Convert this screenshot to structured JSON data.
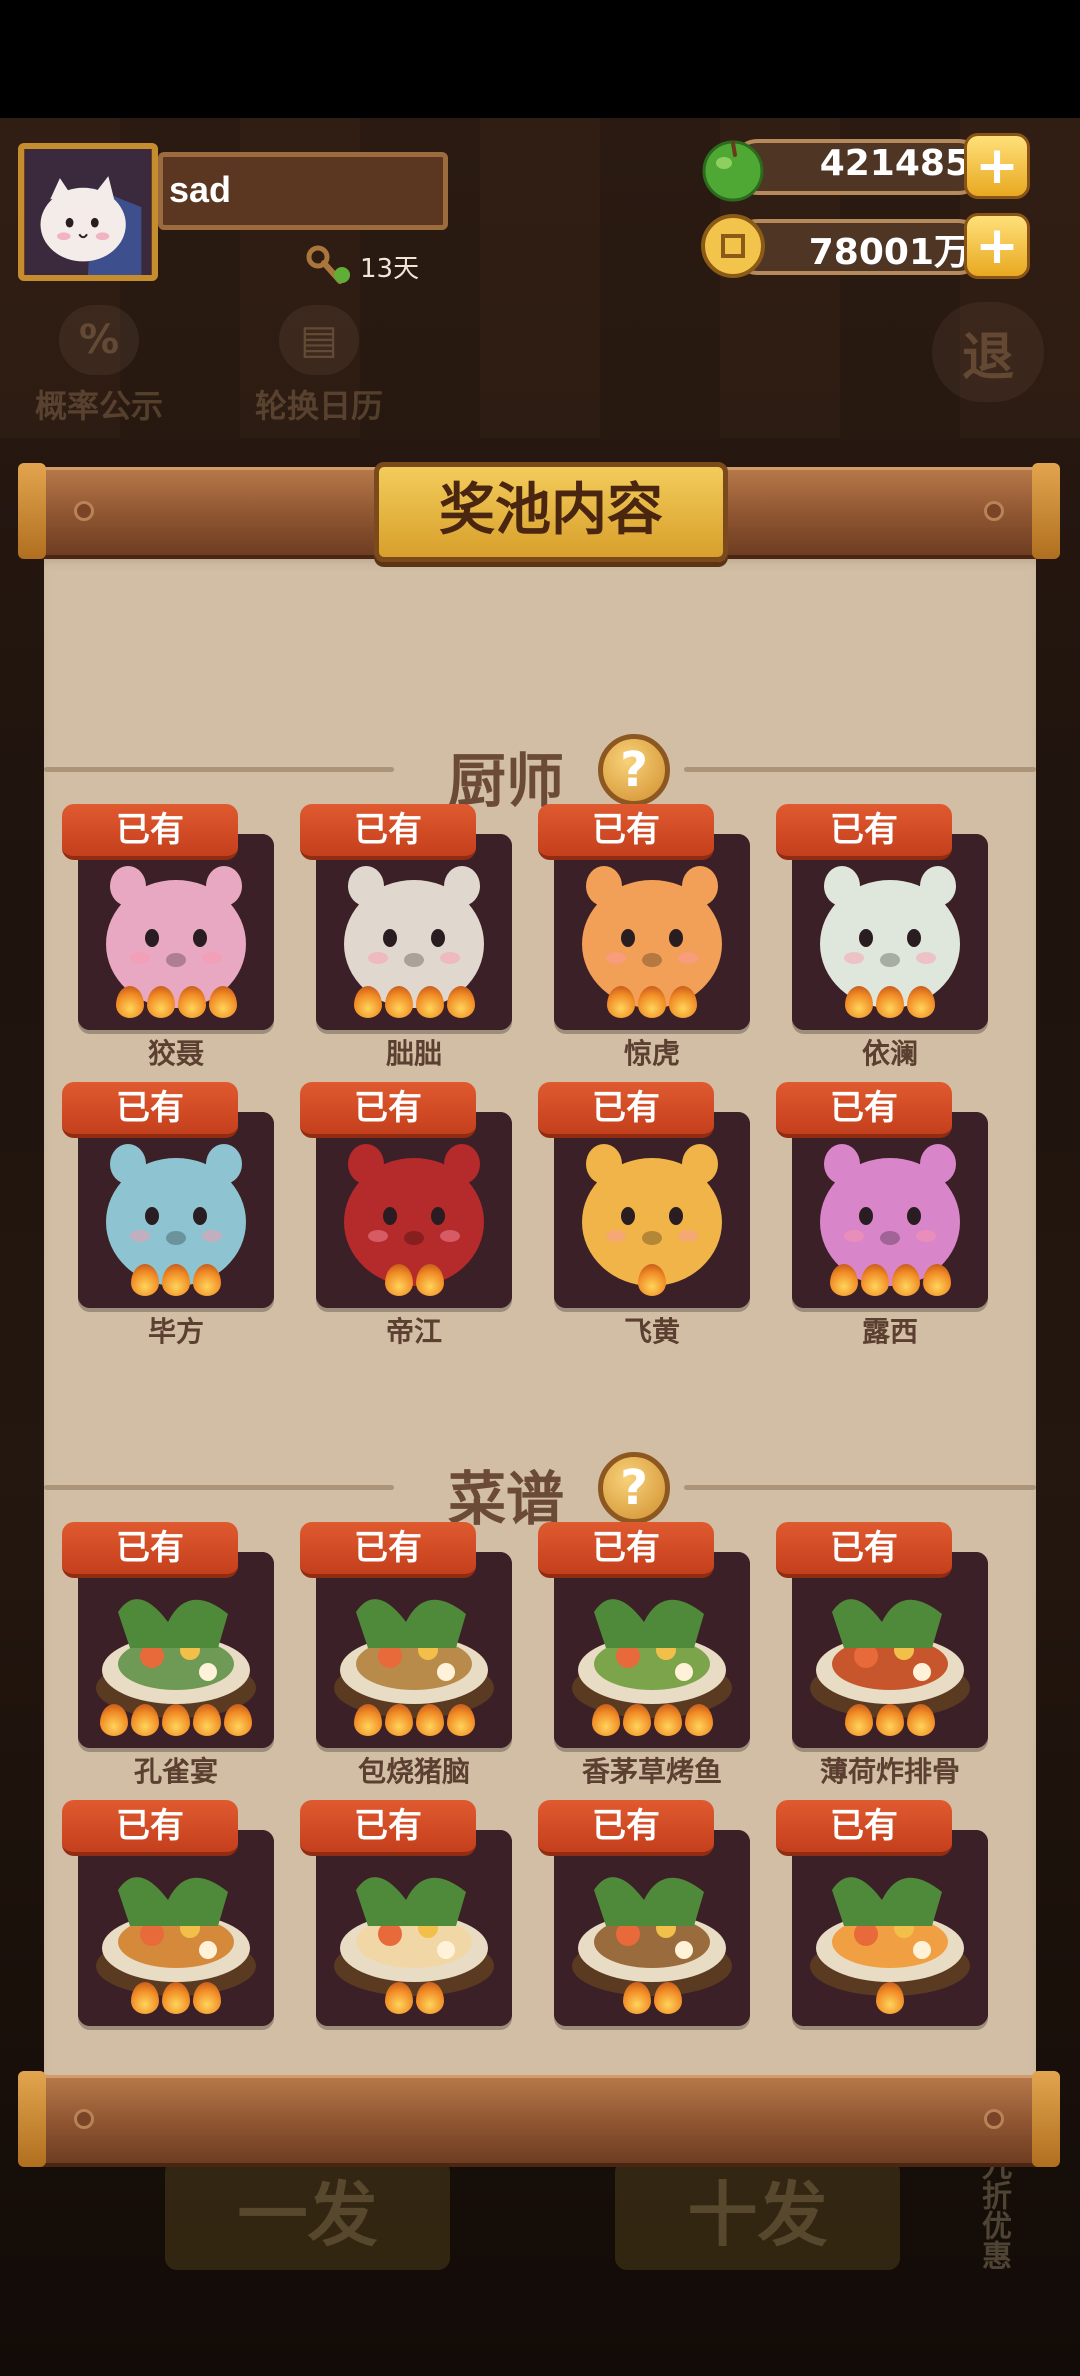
{
  "player": {
    "name": "sad",
    "days": "13天"
  },
  "resources": {
    "apple": "421485",
    "coin": "78001万"
  },
  "background": {
    "rate_label": "概率公示",
    "calendar_label": "轮换日历",
    "exit_label": "退",
    "draw_one_label": "一发",
    "draw_ten_label": "十发",
    "discount_label": "九折优惠"
  },
  "panel": {
    "title": "奖池内容"
  },
  "chef_section": {
    "title": "厨师",
    "help": "?",
    "items": [
      {
        "tag": "已有",
        "name": "狡聂",
        "flames": 4,
        "color": "#e8a8c2"
      },
      {
        "tag": "已有",
        "name": "朏朏",
        "flames": 4,
        "color": "#e0d8cf"
      },
      {
        "tag": "已有",
        "name": "惊虎",
        "flames": 3,
        "color": "#f2a057"
      },
      {
        "tag": "已有",
        "name": "依澜",
        "flames": 3,
        "color": "#dfe6dc"
      },
      {
        "tag": "已有",
        "name": "毕方",
        "flames": 3,
        "color": "#8ec4d1"
      },
      {
        "tag": "已有",
        "name": "帝江",
        "flames": 2,
        "color": "#b52a2a"
      },
      {
        "tag": "已有",
        "name": "飞黄",
        "flames": 1,
        "color": "#f0b448"
      },
      {
        "tag": "已有",
        "name": "露西",
        "flames": 4,
        "color": "#d886c9"
      }
    ]
  },
  "recipe_section": {
    "title": "菜谱",
    "help": "?",
    "items": [
      {
        "tag": "已有",
        "name": "孔雀宴",
        "flames": 5,
        "color": "#6f9a55"
      },
      {
        "tag": "已有",
        "name": "包烧猪脑",
        "flames": 4,
        "color": "#b98b4a"
      },
      {
        "tag": "已有",
        "name": "香茅草烤鱼",
        "flames": 4,
        "color": "#7ca44b"
      },
      {
        "tag": "已有",
        "name": "薄荷炸排骨",
        "flames": 3,
        "color": "#c8562d"
      },
      {
        "tag": "已有",
        "name": "",
        "flames": 3,
        "color": "#d48a3a"
      },
      {
        "tag": "已有",
        "name": "",
        "flames": 2,
        "color": "#f1d7a6"
      },
      {
        "tag": "已有",
        "name": "",
        "flames": 2,
        "color": "#9a6b3c"
      },
      {
        "tag": "已有",
        "name": "",
        "flames": 1,
        "color": "#f0a043"
      }
    ]
  }
}
